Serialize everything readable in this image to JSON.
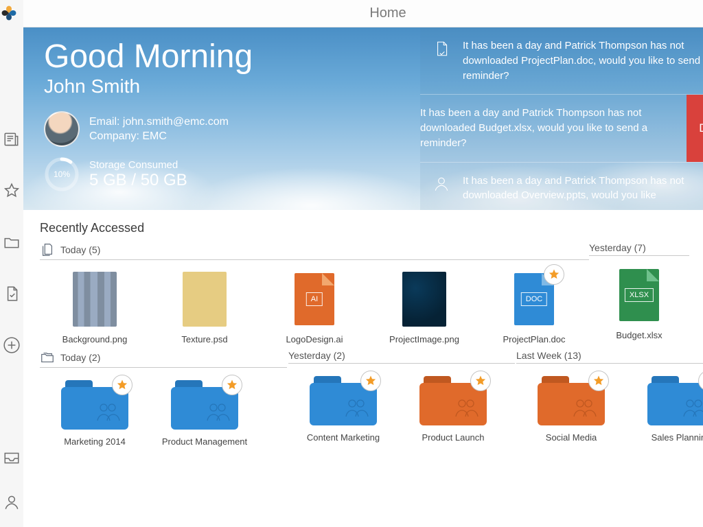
{
  "topbar": {
    "title": "Home"
  },
  "hero": {
    "greeting": "Good Morning",
    "username": "John Smith",
    "email_label": "Email: john.smith@emc.com",
    "company_label": "Company: EMC",
    "storage_label": "Storage Consumed",
    "storage_value": "5 GB / 50 GB",
    "storage_percent": "10%"
  },
  "notices": [
    {
      "icon": "document",
      "text": "It has been a day and Patrick Thompson has not downloaded ProjectPlan.doc, would you like to send a reminder?"
    },
    {
      "icon": "document",
      "text": "It has been a day and Patrick Thompson has not downloaded Budget.xlsx, would you like to send a reminder?",
      "dismiss": "Dismiss"
    },
    {
      "icon": "user",
      "text": "It has been a day and Patrick Thompson has not downloaded Overview.ppts, would you like"
    }
  ],
  "recent": {
    "title": "Recently Accessed",
    "files": {
      "today_label": "Today (5)",
      "yesterday_label": "Yesterday (7)",
      "today_items": [
        {
          "name": "Background.png",
          "type": "image",
          "bg": "linear-gradient(90deg,#7f8ea0 0 12%,#9aabc2 12% 26%,#7f8ea0 26% 40%,#9aabc2 40% 56%,#7f8ea0 56% 72%,#9aabc2 72% 86%,#7f8ea0 86% 100%)"
        },
        {
          "name": "Texture.psd",
          "type": "image",
          "bg": "#e6cc82"
        },
        {
          "name": "LogoDesign.ai",
          "type": "doc",
          "ext": "AI",
          "color": "#e06a2b",
          "fold": "#f2a76f"
        },
        {
          "name": "ProjectImage.png",
          "type": "image",
          "bg": "radial-gradient(circle at 30% 30%, #0a3a5a, #062235 70%)"
        },
        {
          "name": "ProjectPlan.doc",
          "type": "doc",
          "ext": "DOC",
          "color": "#2f8bd6",
          "fold": "#7fb9e6",
          "starred": true
        }
      ],
      "yesterday_items": [
        {
          "name": "Budget.xlsx",
          "type": "doc",
          "ext": "XLSX",
          "color": "#2f8f4e",
          "fold": "#6fc18c"
        }
      ]
    },
    "folders": {
      "today_label": "Today (2)",
      "yesterday_label": "Yesterday (2)",
      "lastweek_label": "Last Week (13)",
      "today_items": [
        {
          "name": "Marketing 2014",
          "color": "#2f8bd6",
          "shade": "#2576ba",
          "starred": true
        },
        {
          "name": "Product Management",
          "color": "#2f8bd6",
          "shade": "#2576ba",
          "starred": true
        }
      ],
      "yesterday_items": [
        {
          "name": "Content Marketing",
          "color": "#2f8bd6",
          "shade": "#2576ba",
          "starred": true
        },
        {
          "name": "Product Launch",
          "color": "#e06a2b",
          "shade": "#c05820",
          "starred": true
        }
      ],
      "lastweek_items": [
        {
          "name": "Social Media",
          "color": "#e06a2b",
          "shade": "#c05820",
          "starred": true
        },
        {
          "name": "Sales Planning",
          "color": "#2f8bd6",
          "shade": "#2576ba",
          "starred": true
        }
      ]
    }
  }
}
